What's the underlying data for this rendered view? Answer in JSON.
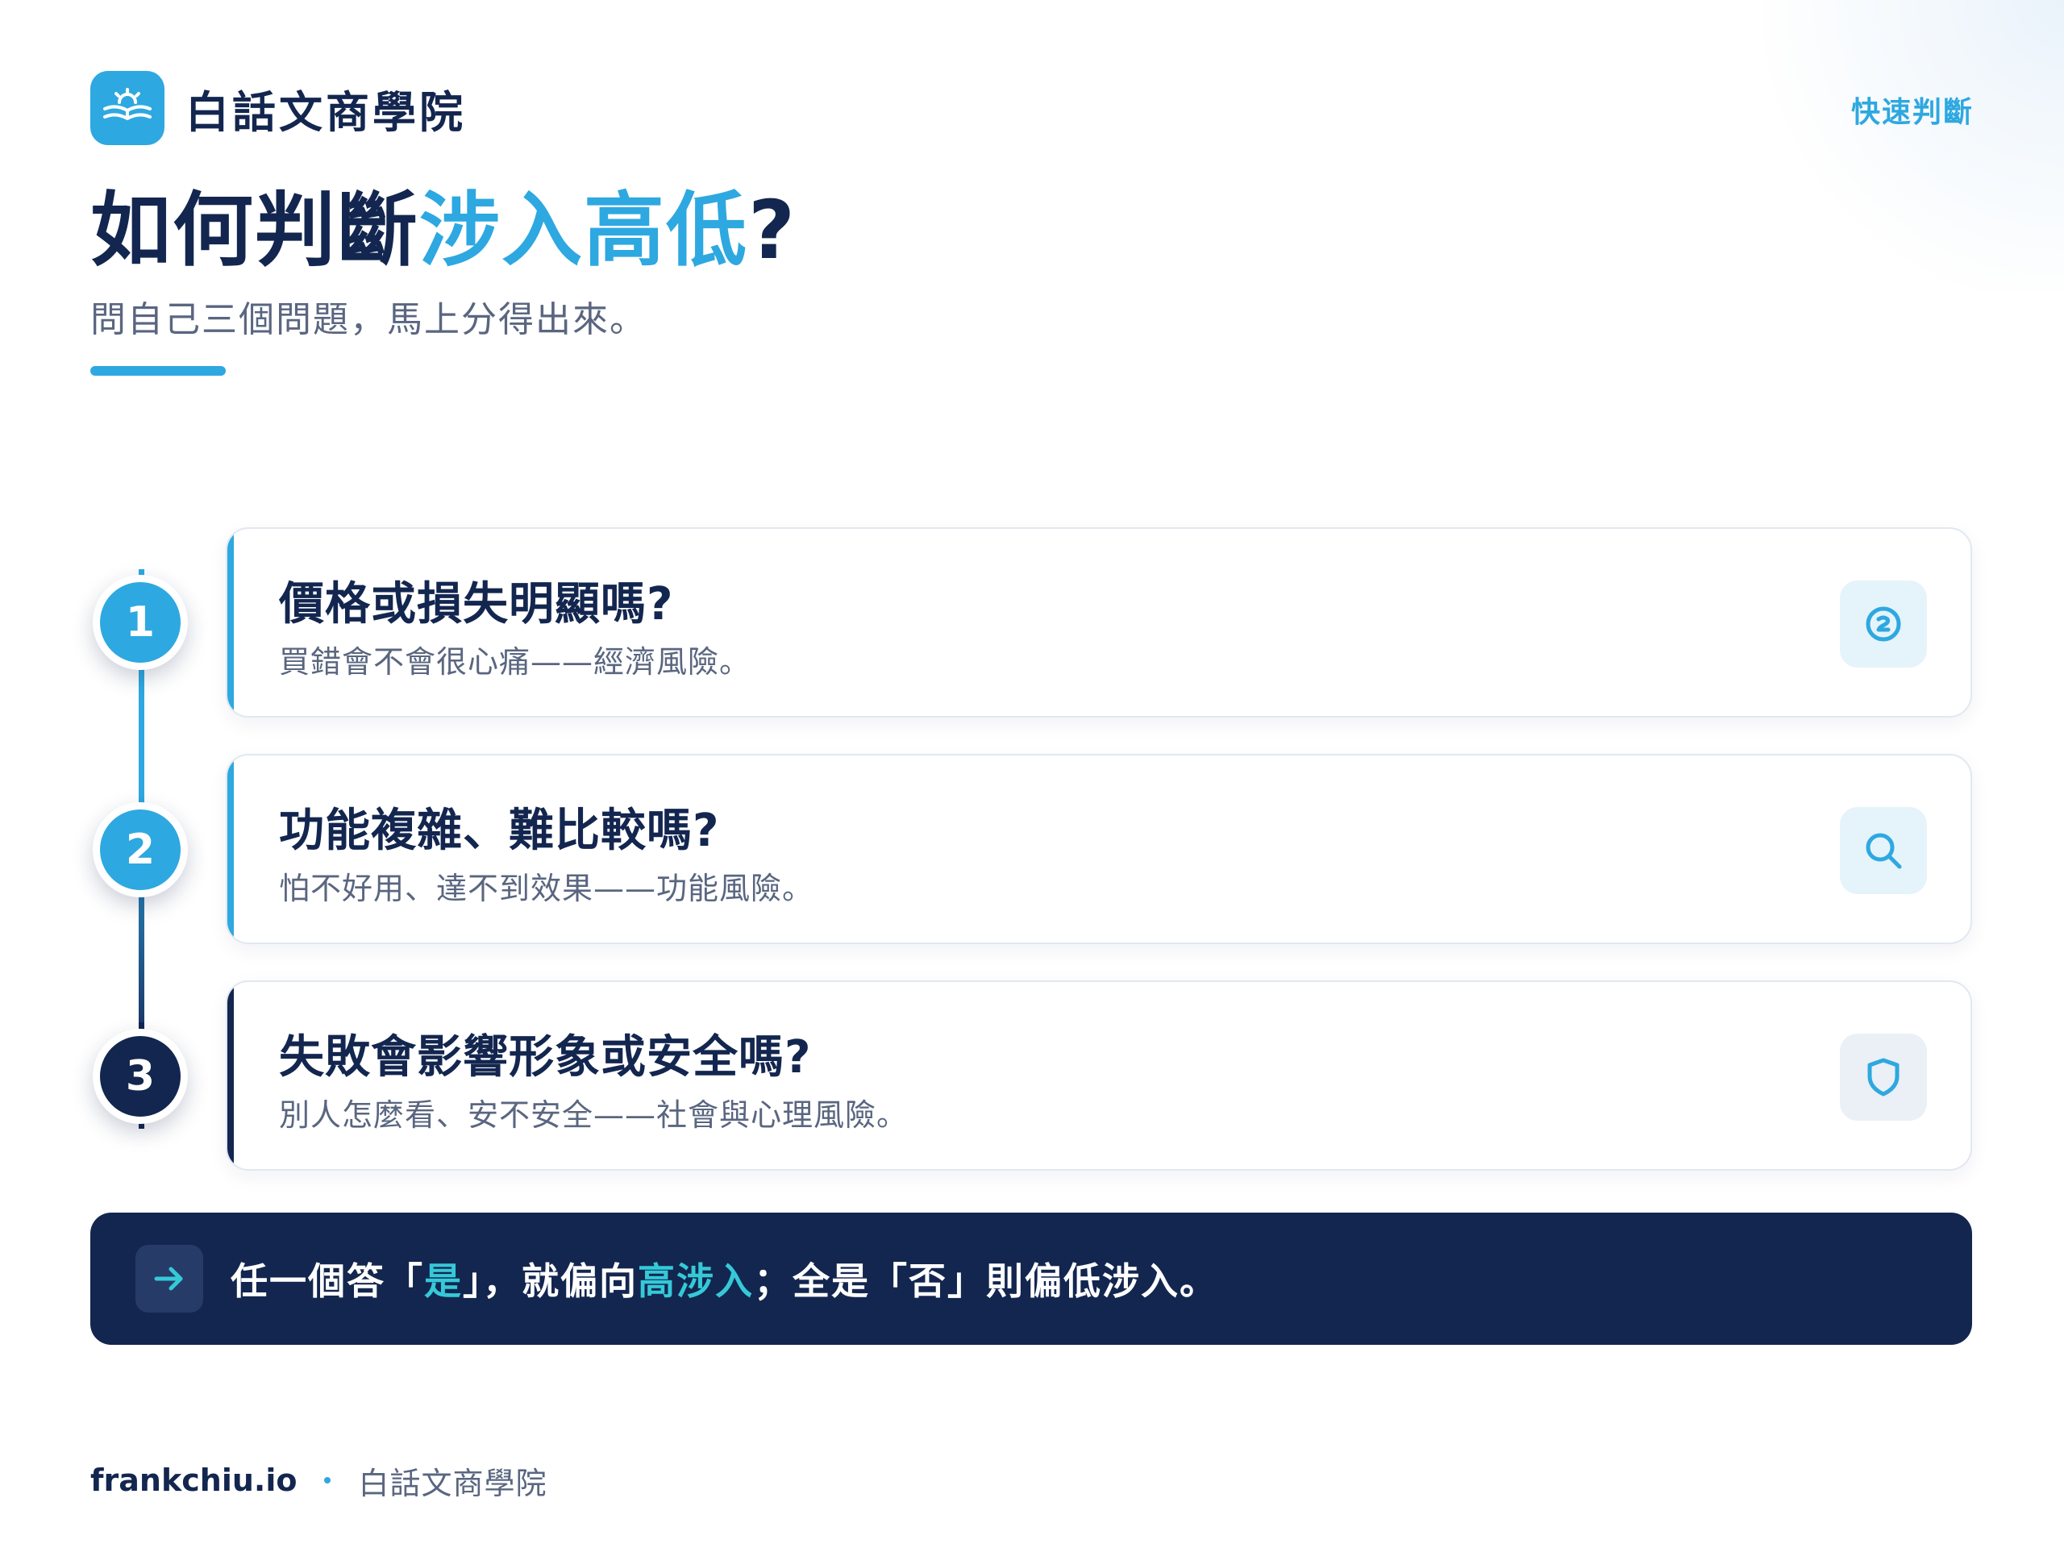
{
  "brand": {
    "name": "白話文商學院",
    "logo_icon": "open-book-sun-icon"
  },
  "header": {
    "tag": "快速判斷"
  },
  "title": {
    "main": "如何判斷",
    "accent": "涉入高低",
    "suffix": "?"
  },
  "subtitle": "問自己三個問題，馬上分得出來。",
  "questions": [
    {
      "number": "1",
      "title": "價格或損失明顯嗎?",
      "desc": "買錯會不會很心痛——經濟風險。",
      "icon": "coin-icon"
    },
    {
      "number": "2",
      "title": "功能複雜、難比較嗎?",
      "desc": "怕不好用、達不到效果——功能風險。",
      "icon": "search-icon"
    },
    {
      "number": "3",
      "title": "失敗會影響形象或安全嗎?",
      "desc": "別人怎麼看、安不安全——社會與心理風險。",
      "icon": "shield-icon"
    }
  ],
  "summary": {
    "icon": "arrow-right-icon",
    "part1": "任一個答「",
    "yes": "是",
    "part2": "」，就偏向",
    "high": "高涉入",
    "part3": "；全是「否」則偏低涉入。"
  },
  "footer": {
    "site": "frankchiu.io",
    "name": "白話文商學院"
  },
  "colors": {
    "navy": "#13264f",
    "accent": "#2ea8e0",
    "highlight": "#35c9d8",
    "muted": "#5a6680"
  }
}
